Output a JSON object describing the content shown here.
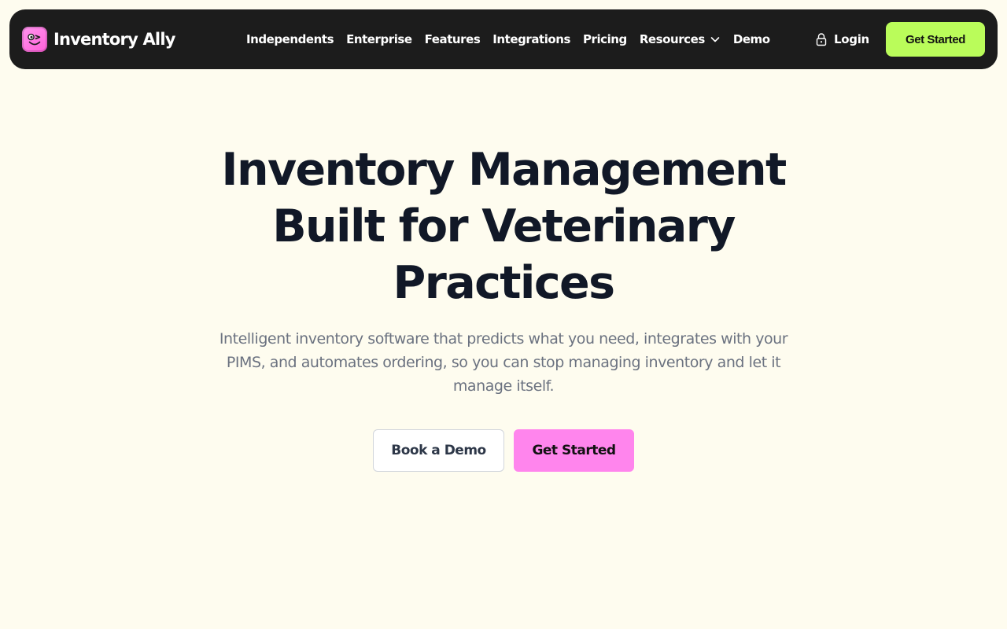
{
  "brand": {
    "name": "Inventory Ally",
    "logo_icon": "winking-face-logo-icon",
    "logo_color": "#ff7fe6"
  },
  "nav": {
    "items": [
      {
        "label": "Independents"
      },
      {
        "label": "Enterprise"
      },
      {
        "label": "Features"
      },
      {
        "label": "Integrations"
      },
      {
        "label": "Pricing"
      },
      {
        "label": "Resources",
        "icon": "chevron-down-icon"
      },
      {
        "label": "Demo"
      }
    ],
    "login_label": "Login",
    "login_icon": "lock-icon",
    "cta_label": "Get Started",
    "cta_color": "#bafc5a",
    "background": "#1c1c1c"
  },
  "hero": {
    "title_line1": "Inventory Management",
    "title_line2": "Built for Veterinary",
    "title_line3": "Practices",
    "subtitle": "Intelligent inventory software that predicts what you need, integrates with your PIMS, and automates ordering, so you can stop managing inventory and let it manage itself.",
    "primary_button": "Get Started",
    "primary_color": "#ff85ed",
    "secondary_button": "Book a Demo"
  },
  "page_background": "#fefcef"
}
